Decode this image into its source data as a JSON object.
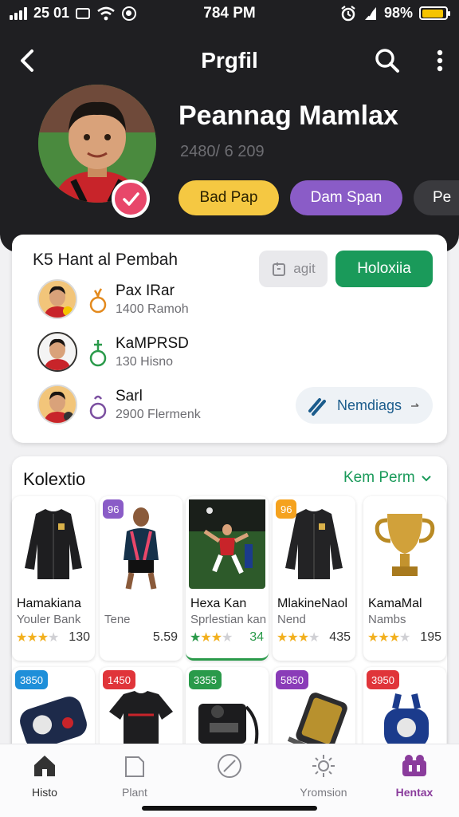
{
  "status_bar": {
    "left_text": "25 01",
    "time": "784 PM",
    "battery": "98%",
    "battery_level": 0.9
  },
  "nav": {
    "title": "Prgfil"
  },
  "profile": {
    "name": "Peannag Mamlax",
    "subtitle": "2480/ 6 209",
    "chips": [
      "Bad Pap",
      "Dam Span",
      "Pe"
    ]
  },
  "follow_card": {
    "title": "K5 Hant al Pembah",
    "edit_label": "agit",
    "follow_label": "Holoxiia",
    "rows": [
      {
        "name": "Pax IRar",
        "meta": "1400 Ramoh"
      },
      {
        "name": "KaMPRSD",
        "meta": "130 Hisno"
      },
      {
        "name": "Sarl",
        "meta": "2900 Flermenk"
      }
    ],
    "message_label": "Nemdiags"
  },
  "collection": {
    "title": "Kolextio",
    "more_label": "Kem Perm",
    "items": [
      {
        "name": "Hamakiana",
        "sub": "Youler Bank",
        "count": "130",
        "badge": ""
      },
      {
        "name": "",
        "sub": "Tene",
        "count": "5.59",
        "badge": "96"
      },
      {
        "name": "Hexa Kan",
        "sub": "Sprlestian kan",
        "count": "34",
        "badge": ""
      },
      {
        "name": "MlakineNaol",
        "sub": "Nend",
        "count": "435",
        "badge": "96"
      },
      {
        "name": "KamaMal",
        "sub": "Nambs",
        "count": "195",
        "badge": ""
      }
    ],
    "prices": [
      "3850",
      "1450",
      "3355",
      "5850",
      "3950"
    ]
  },
  "tabs": [
    "Histo",
    "Plant",
    "",
    "Yromsion",
    "Hentax"
  ],
  "colors": {
    "accent_green": "#1a9a5a",
    "header_bg": "#1f1f22",
    "chip_yellow": "#f5c842",
    "chip_purple": "#8a5cc7",
    "active_tab": "#8a3c9c"
  }
}
